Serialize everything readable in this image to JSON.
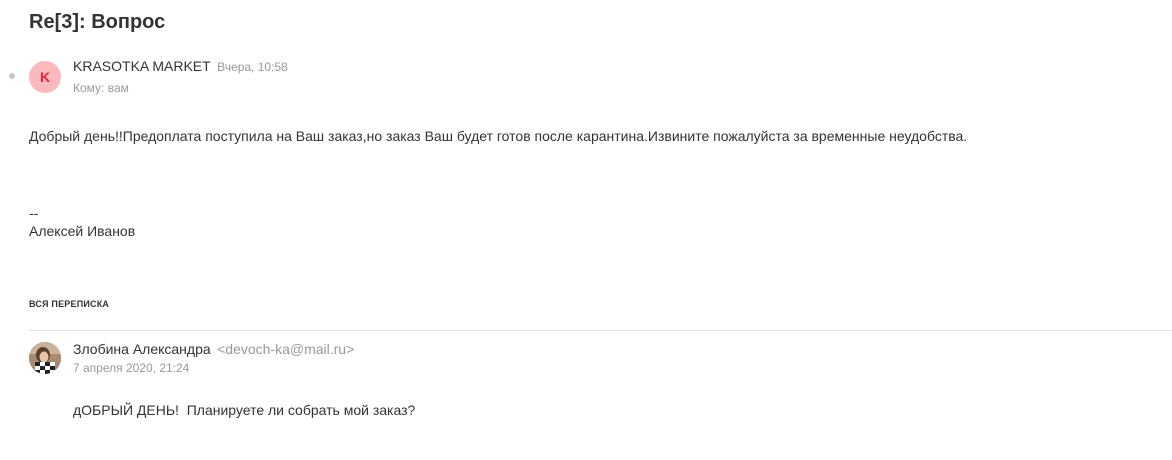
{
  "message": {
    "subject": "Re[3]: Вопрос",
    "sender": {
      "avatar_letter": "K",
      "name": "KRASOTKA MARKET",
      "date": "Вчера, 10:58"
    },
    "recipient_line": "Кому: вам",
    "body": "Добрый день!!Предоплата поступила на Ваш заказ,но заказ Ваш будет готов после карантина.Извините пожалуйста за временные неудобства.",
    "signature_separator": "--",
    "signature_name": "Алексей Иванов"
  },
  "thread": {
    "heading": "ВСЯ ПЕРЕПИСКА",
    "items": [
      {
        "sender_name": "Злобина Александра",
        "sender_email": "<devoch-ka@mail.ru>",
        "date": "7 апреля 2020, 21:24",
        "body": "дОБРЫЙ ДЕНЬ!  Планируете ли собрать мой заказ?"
      }
    ]
  },
  "colors": {
    "avatar_letter_bg": "#fbb9bd",
    "avatar_letter_fg": "#e0263a",
    "muted_text": "#999999",
    "main_text": "#333333"
  },
  "icons": {
    "unread_indicator": "unread-dot-icon",
    "reply_avatar": "user-photo-avatar"
  }
}
